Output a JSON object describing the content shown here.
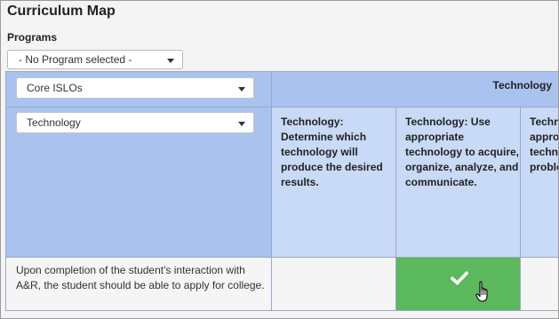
{
  "page": {
    "title": "Curriculum Map"
  },
  "programs": {
    "label": "Programs",
    "selected": "- No Program selected -"
  },
  "grid": {
    "category_select": "Core ISLOs",
    "subcategory_select": "Technology",
    "group_header": "Technology",
    "outcomes": [
      "Technology: Determine which technology will produce the desired results.",
      "Technology: Use appropriate technology to acquire, organize, analyze, and communicate.",
      "Technology: Use appropriate technology to solve problems."
    ],
    "rows": [
      {
        "label": "Upon completion of the student's interaction with A&R, the student should be able to apply for college.",
        "mapped": [
          false,
          true,
          false
        ]
      }
    ]
  },
  "colors": {
    "header_dark": "#a9c3ee",
    "header_light": "#c8daf6",
    "check_cell": "#5cb85c",
    "border": "#9aa8c8"
  },
  "icons": {
    "dropdown": "chevron-down-icon",
    "mapped": "checkmark-icon",
    "cursor": "hand-pointer-icon"
  }
}
